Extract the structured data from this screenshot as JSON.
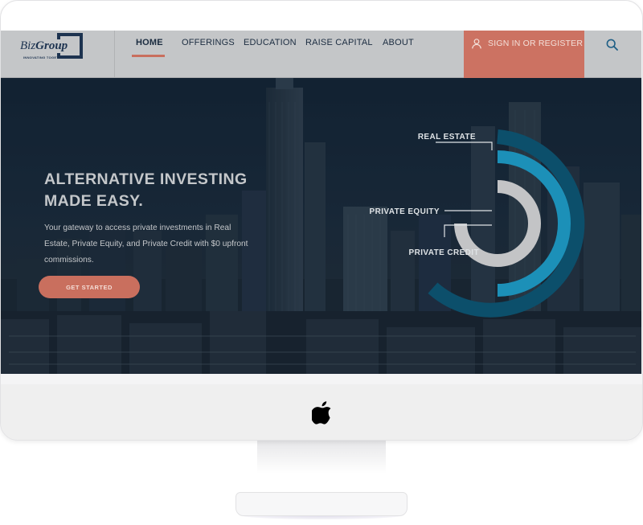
{
  "brand": {
    "name_prefix": "Biz",
    "name_suffix": "Group",
    "tagline": "INNOVATING TOGETHER"
  },
  "nav": {
    "items": [
      {
        "label": "HOME",
        "active": true
      },
      {
        "label": "OFFERINGS",
        "active": false
      },
      {
        "label": "EDUCATION",
        "active": false
      },
      {
        "label": "RAISE CAPITAL",
        "active": false
      },
      {
        "label": "ABOUT",
        "active": false
      }
    ],
    "signin_label": "SIGN IN OR REGISTER",
    "search_icon": "search-icon",
    "user_icon": "user-icon"
  },
  "hero": {
    "headline_line1": "ALTERNATIVE INVESTING",
    "headline_line2": "MADE EASY.",
    "subtext": "Your gateway to access private investments in Real Estate, Private Equity, and Private Credit with $0 upfront commissions.",
    "cta_label": "GET STARTED"
  },
  "rings": [
    {
      "label": "REAL ESTATE",
      "color": "#0c4f6b"
    },
    {
      "label": "PRIVATE EQUITY",
      "color": "#1c90b8"
    },
    {
      "label": "PRIVATE CREDIT",
      "color": "#c3c4c6"
    }
  ],
  "colors": {
    "accent": "#c96f5e",
    "nav_bg": "#c4c6c8",
    "brand_navy": "#1d3350"
  },
  "device": {
    "chin_icon": "apple-logo-icon"
  }
}
